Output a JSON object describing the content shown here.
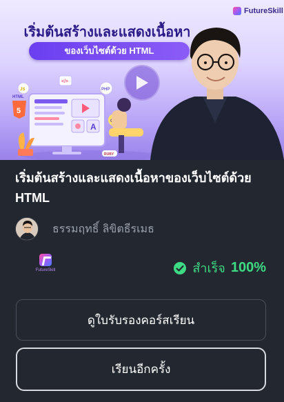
{
  "thumbnail": {
    "brand": "FutureSkill",
    "headline": "เริ่มต้นสร้างและแสดงเนื้อหา",
    "subheadline": "ของเว็บไซต์ด้วย HTML",
    "illustration_labels": [
      "JS",
      "PHP",
      "HTML",
      "CSS",
      "RUBY",
      "A"
    ]
  },
  "course": {
    "title": "เริ่มต้นสร้างและแสดงเนื้อหาของเว็บไซต์ด้วย HTML",
    "instructor": "ธรรมฤทธิ์ ลิขิตธีรเมธ"
  },
  "provider": {
    "logo_text": "FutureSkill"
  },
  "progress": {
    "status_label": "สำเร็จ",
    "percent_label": "100%",
    "percent_value": 100
  },
  "buttons": {
    "certificate": "ดูใบรับรองคอร์สเรียน",
    "relearn": "เรียนอีกครั้ง"
  },
  "colors": {
    "background": "#23272f",
    "success": "#3ddc84",
    "thumbnail_accent": "#6a3ff0"
  }
}
